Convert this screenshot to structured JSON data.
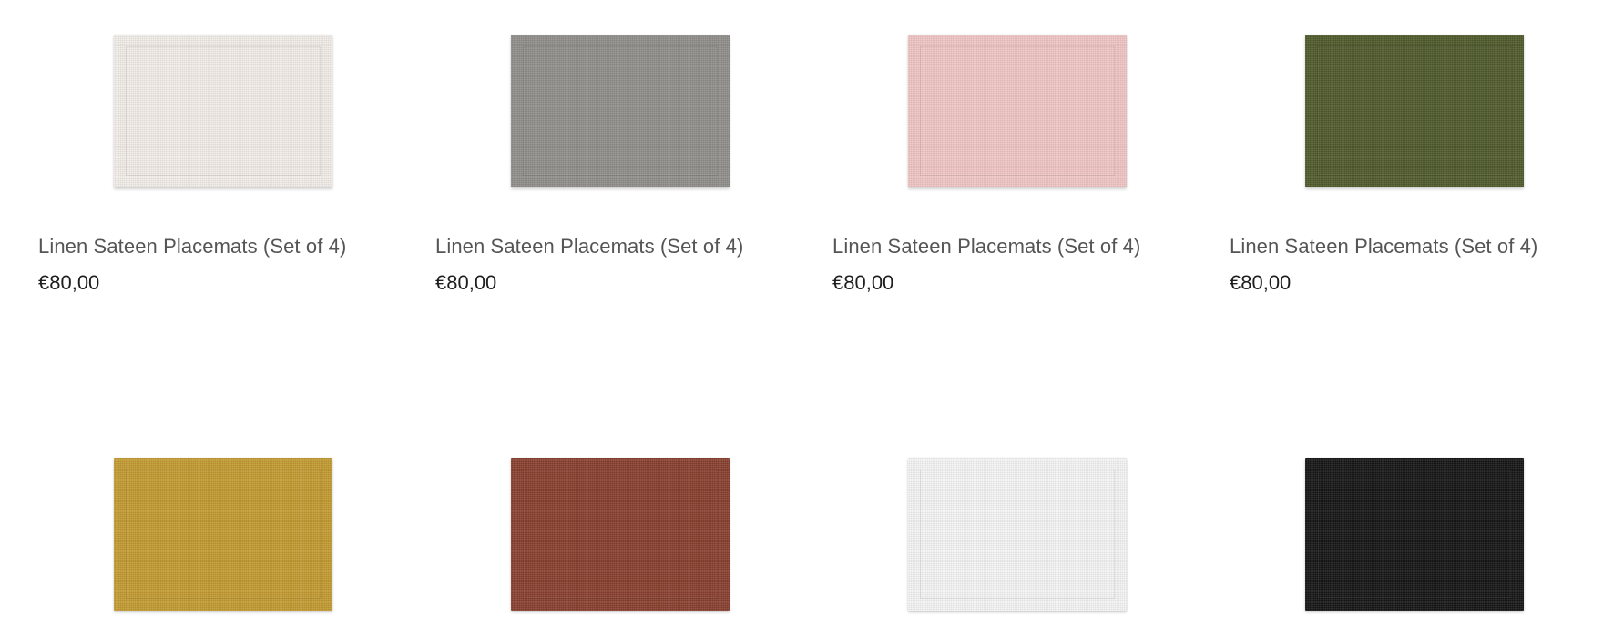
{
  "products": [
    {
      "title": "Linen Sateen Placemats (Set of 4)",
      "price": "€80,00",
      "swatch_color": "#f1ece7"
    },
    {
      "title": "Linen Sateen Placemats (Set of 4)",
      "price": "€80,00",
      "swatch_color": "#8f8e8b"
    },
    {
      "title": "Linen Sateen Placemats (Set of 4)",
      "price": "€80,00",
      "swatch_color": "#efc5c4"
    },
    {
      "title": "Linen Sateen Placemats (Set of 4)",
      "price": "€80,00",
      "swatch_color": "#4f5a2b"
    },
    {
      "swatch_color": "#c29a32"
    },
    {
      "swatch_color": "#883f2f"
    },
    {
      "swatch_color": "#f4f4f4"
    },
    {
      "swatch_color": "#151515"
    }
  ]
}
